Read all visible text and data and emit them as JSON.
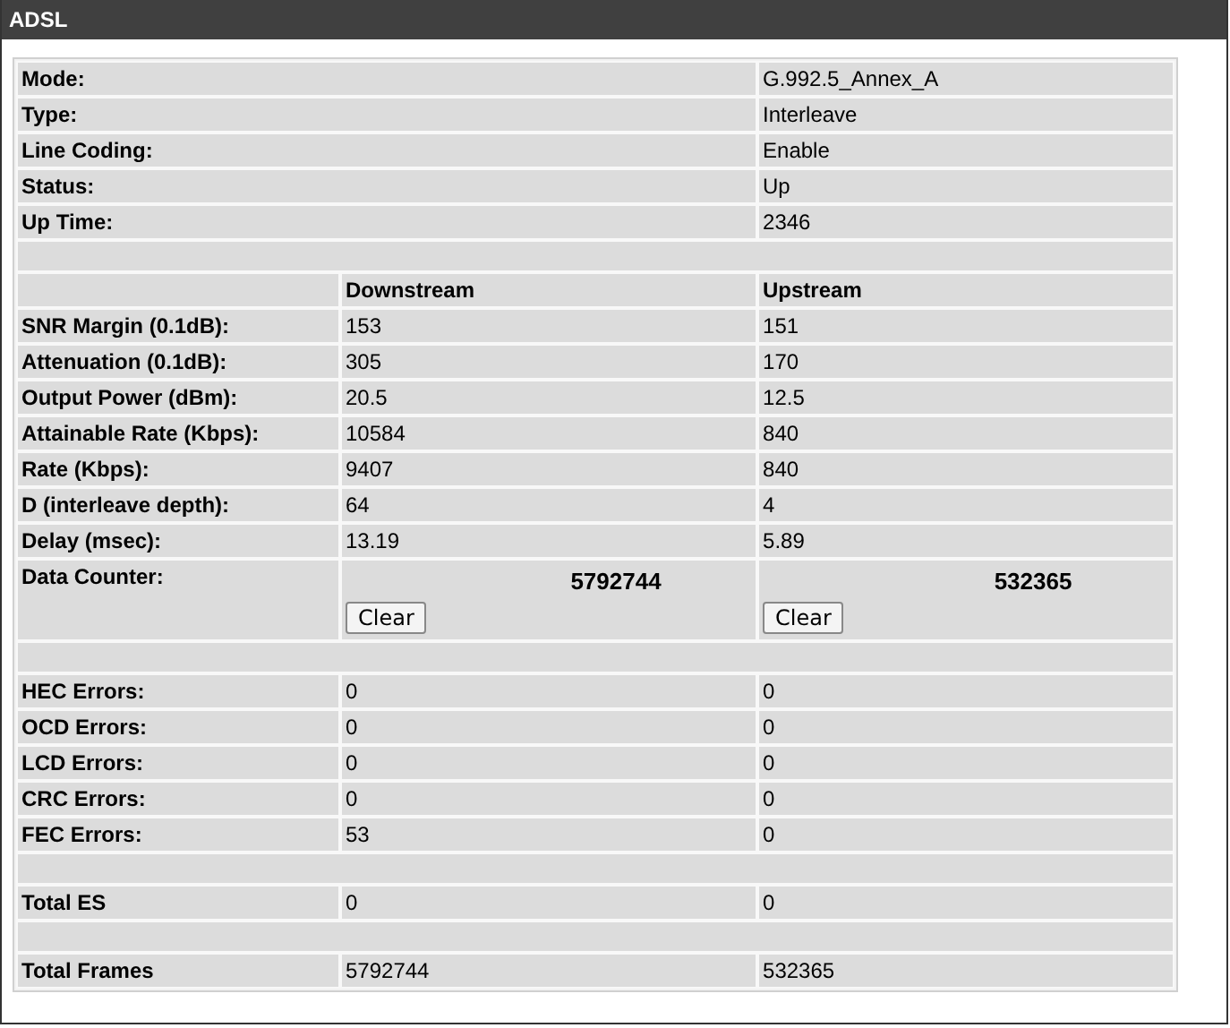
{
  "title": "ADSL",
  "rows": [
    {
      "kind": "info",
      "label": "Mode:",
      "value": "G.992.5_Annex_A"
    },
    {
      "kind": "info",
      "label": "Type:",
      "value": "Interleave"
    },
    {
      "kind": "info",
      "label": "Line Coding:",
      "value": "Enable"
    },
    {
      "kind": "info",
      "label": "Status:",
      "value": "Up"
    },
    {
      "kind": "info",
      "label": "Up Time:",
      "value": "2346"
    },
    {
      "kind": "spacer"
    },
    {
      "kind": "header",
      "down": "Downstream",
      "up": "Upstream"
    },
    {
      "kind": "stat",
      "label": "SNR Margin (0.1dB):",
      "down": "153",
      "up": "151"
    },
    {
      "kind": "stat",
      "label": "Attenuation (0.1dB):",
      "down": "305",
      "up": "170"
    },
    {
      "kind": "stat",
      "label": "Output Power (dBm):",
      "down": "20.5",
      "up": "12.5"
    },
    {
      "kind": "stat",
      "label": "Attainable Rate (Kbps):",
      "down": "10584",
      "up": "840"
    },
    {
      "kind": "stat",
      "label": "Rate (Kbps):",
      "down": "9407",
      "up": "840"
    },
    {
      "kind": "stat",
      "label": "D (interleave depth):",
      "down": "64",
      "up": "4"
    },
    {
      "kind": "stat",
      "label": "Delay (msec):",
      "down": "13.19",
      "up": "5.89"
    },
    {
      "kind": "counter",
      "label": "Data Counter:",
      "down": "5792744",
      "up": "532365",
      "down_button": "Clear",
      "up_button": "Clear"
    },
    {
      "kind": "spacer"
    },
    {
      "kind": "stat",
      "label": "HEC Errors:",
      "down": "0",
      "up": "0"
    },
    {
      "kind": "stat",
      "label": "OCD Errors:",
      "down": "0",
      "up": "0"
    },
    {
      "kind": "stat",
      "label": "LCD Errors:",
      "down": "0",
      "up": "0"
    },
    {
      "kind": "stat",
      "label": "CRC Errors:",
      "down": "0",
      "up": "0"
    },
    {
      "kind": "stat",
      "label": "FEC Errors:",
      "down": "53",
      "up": "0"
    },
    {
      "kind": "spacer"
    },
    {
      "kind": "stat",
      "label": "Total ES",
      "down": "0",
      "up": "0"
    },
    {
      "kind": "spacer"
    },
    {
      "kind": "stat",
      "label": "Total Frames",
      "down": "5792744",
      "up": "532365"
    }
  ]
}
